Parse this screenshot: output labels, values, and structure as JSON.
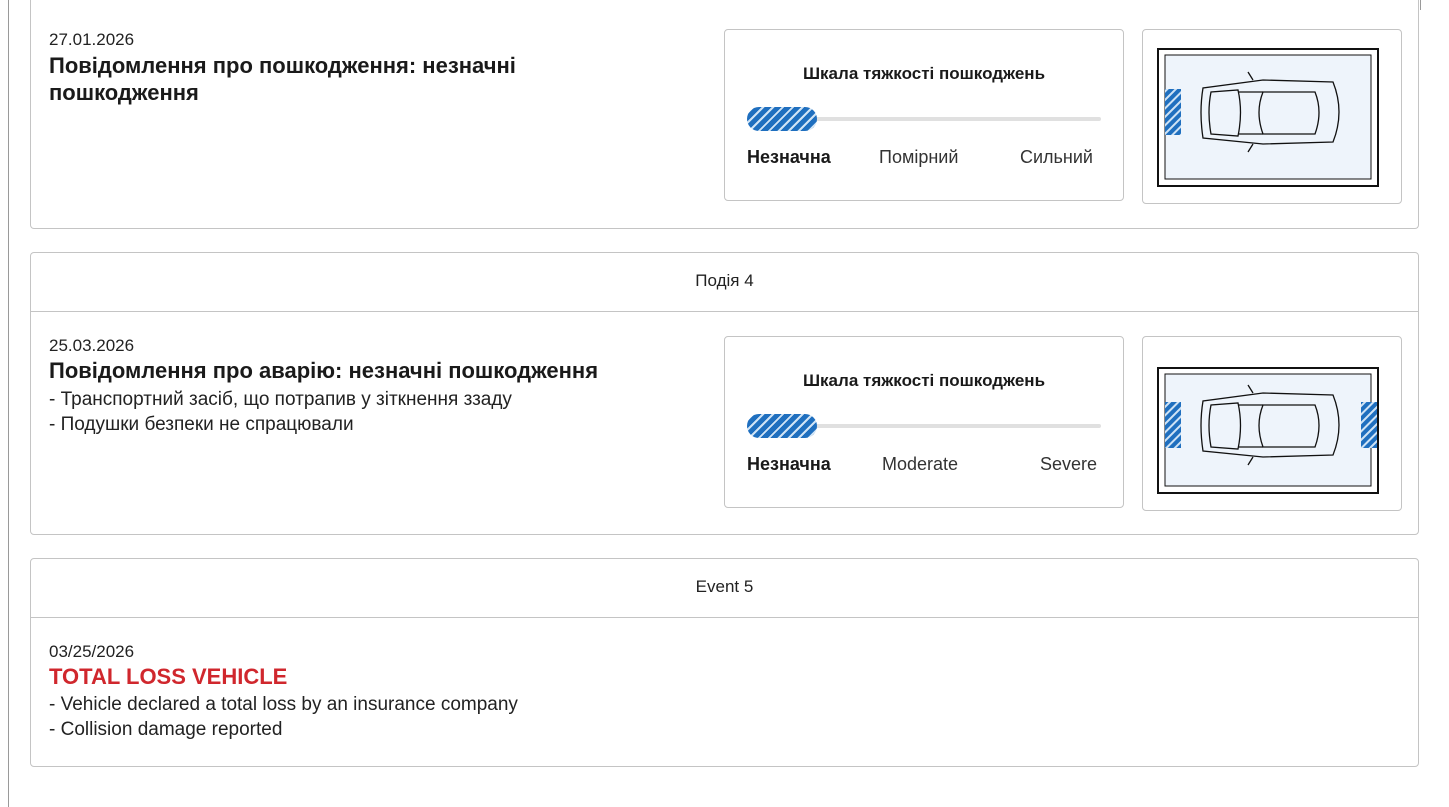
{
  "events": [
    {
      "header": "",
      "date": "27.01.2026",
      "title": "Повідомлення про пошкодження: незначні пошкодження",
      "bullets": [],
      "severity": {
        "title": "Шкала тяжкості пошкоджень",
        "labels": [
          "Незначна",
          "Помірний",
          "Сильний"
        ],
        "selected": "Незначна"
      },
      "damage_zones": [
        "rear"
      ]
    },
    {
      "header": "Подія 4",
      "date": "25.03.2026",
      "title": "Повідомлення про аварію: незначні пошкодження",
      "bullets": [
        "- Транспортний засіб, що потрапив у зіткнення ззаду",
        "- Подушки безпеки не спрацювали"
      ],
      "severity": {
        "title": "Шкала тяжкості пошкоджень",
        "labels": [
          "Незначна",
          "Moderate",
          "Severe"
        ],
        "selected": "Незначна"
      },
      "damage_zones": [
        "rear",
        "front"
      ]
    },
    {
      "header": "Event 5",
      "date": "03/25/2026",
      "title": "TOTAL LOSS VEHICLE",
      "title_color": "#d0272d",
      "bullets": [
        "- Vehicle declared a total loss by an insurance company",
        "- Collision damage reported"
      ]
    }
  ],
  "colors": {
    "damage": "#1f6fbf",
    "car_area": "#eef4fb",
    "alert": "#d0272d"
  }
}
